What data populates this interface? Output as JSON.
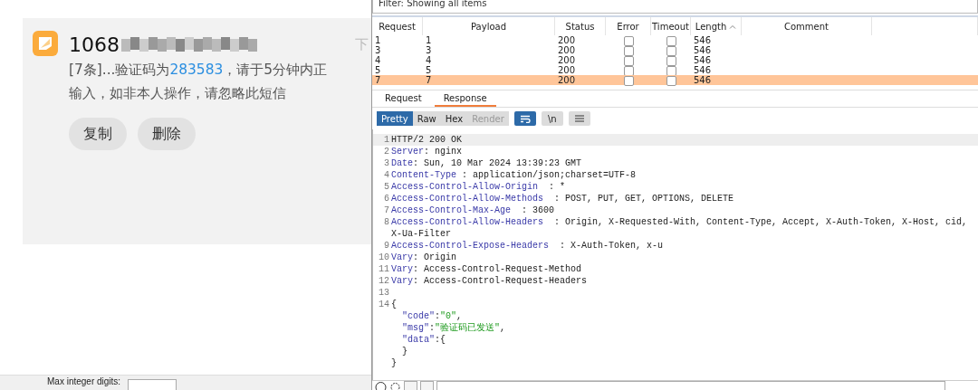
{
  "notification": {
    "sender": "1068",
    "time": "下",
    "body_line1": {
      "before": "[7条]...验证码为",
      "code": "283583",
      "after": "，请于5分钟内正"
    },
    "body_line2": "输入，如非本人操作，请忽略此短信",
    "actions": [
      "复制",
      "删除"
    ]
  },
  "lower_form": {
    "label": "Max integer digits:"
  },
  "filter": {
    "text": "Filter: Showing all items"
  },
  "table": {
    "columns": [
      "Request",
      "Payload",
      "Status",
      "Error",
      "Timeout",
      "Length",
      "Comment"
    ],
    "rows": [
      {
        "request": "1",
        "payload": "1",
        "status": "200",
        "error": false,
        "timeout": false,
        "length": "546",
        "selected": false
      },
      {
        "request": "3",
        "payload": "3",
        "status": "200",
        "error": false,
        "timeout": false,
        "length": "546",
        "selected": false
      },
      {
        "request": "4",
        "payload": "4",
        "status": "200",
        "error": false,
        "timeout": false,
        "length": "546",
        "selected": false
      },
      {
        "request": "5",
        "payload": "5",
        "status": "200",
        "error": false,
        "timeout": false,
        "length": "546",
        "selected": false
      },
      {
        "request": "7",
        "payload": "7",
        "status": "200",
        "error": false,
        "timeout": false,
        "length": "546",
        "selected": true
      }
    ]
  },
  "message_tabs": [
    {
      "label": "Request",
      "selected": false
    },
    {
      "label": "Response",
      "selected": true
    }
  ],
  "view_modes": [
    {
      "label": "Pretty",
      "selected": true,
      "disabled": false
    },
    {
      "label": "Raw",
      "selected": false,
      "disabled": false
    },
    {
      "label": "Hex",
      "selected": false,
      "disabled": false
    },
    {
      "label": "Render",
      "selected": false,
      "disabled": true
    }
  ],
  "newline_toggle": "\\n",
  "response_lines": [
    {
      "kind": "plain",
      "number": "1",
      "text": "HTTP/2 200 OK"
    },
    {
      "kind": "header",
      "number": "2",
      "key": "Server",
      "value": ": nginx"
    },
    {
      "kind": "header",
      "number": "3",
      "key": "Date",
      "value": ": Sun, 10 Mar 2024 13:39:23 GMT"
    },
    {
      "kind": "header",
      "number": "4",
      "key": "Content-Type",
      "value": " : application/json;charset=UTF-8"
    },
    {
      "kind": "header",
      "number": "5",
      "key": "Access-Control-Allow-Origin",
      "value": "  : *"
    },
    {
      "kind": "header",
      "number": "6",
      "key": "Access-Control-Allow-Methods",
      "value": "  : POST, PUT, GET, OPTIONS, DELETE"
    },
    {
      "kind": "header",
      "number": "7",
      "key": "Access-Control-Max-Age",
      "value": "  : 3600"
    },
    {
      "kind": "header",
      "number": "8",
      "key": "Access-Control-Allow-Headers",
      "value": "  : Origin, X-Requested-With, Content-Type, Accept, X-Auth-Token, X-Host, cid,"
    },
    {
      "kind": "plain",
      "text": "X-Ua-Filter"
    },
    {
      "kind": "header",
      "number": "9",
      "key": "Access-Control-Expose-Headers",
      "value": "  : X-Auth-Token, x-u"
    },
    {
      "kind": "header",
      "number": "10",
      "key": "Vary",
      "value": ": Origin"
    },
    {
      "kind": "header",
      "number": "11",
      "key": "Vary",
      "value": ": Access-Control-Request-Method"
    },
    {
      "kind": "header",
      "number": "12",
      "key": "Vary",
      "value": ": Access-Control-Request-Headers"
    },
    {
      "kind": "plain",
      "number": "13"
    },
    {
      "kind": "plain",
      "number": "14",
      "text": "{"
    },
    {
      "kind": "json",
      "key": "\"code\"",
      "sep": ":",
      "value": "\"0\"",
      "tail": ","
    },
    {
      "kind": "json",
      "key": "\"msg\"",
      "sep": ":",
      "value": "\"验证码已发送\"",
      "tail": ","
    },
    {
      "kind": "json",
      "key": "\"data\"",
      "sep": ":",
      "tail": "{"
    },
    {
      "kind": "plain",
      "text": "  }"
    },
    {
      "kind": "plain",
      "text": "}"
    }
  ]
}
